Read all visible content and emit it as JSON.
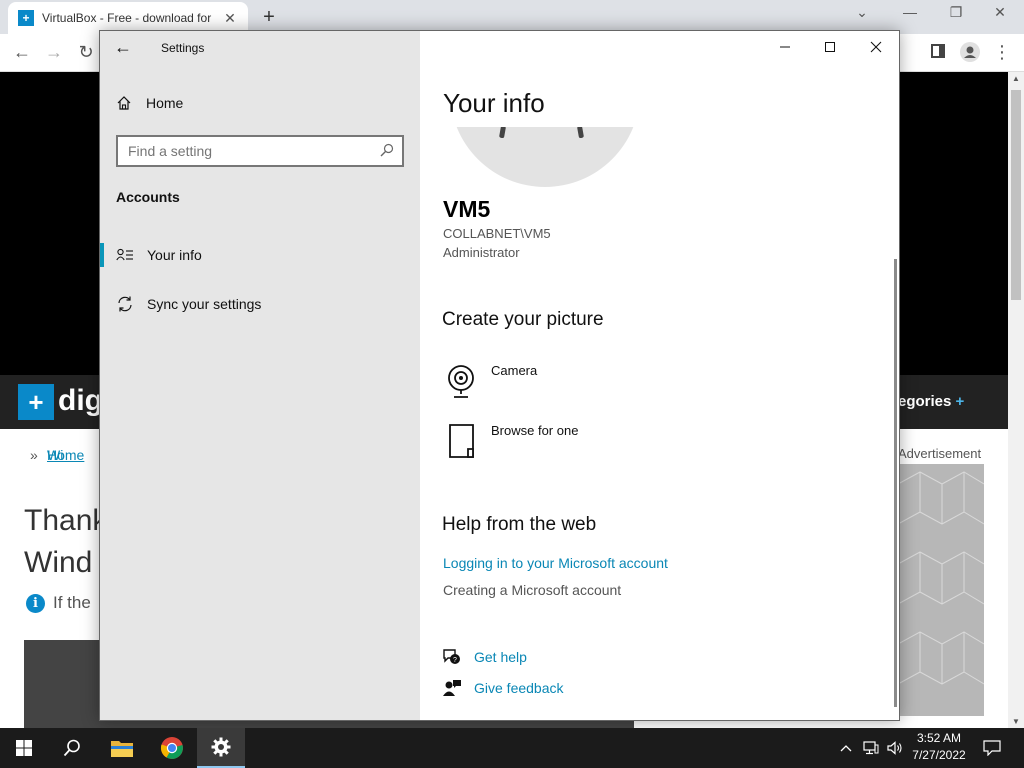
{
  "browser": {
    "tab_title": "VirtualBox - Free - download for",
    "tab_favicon": "digitaltrends-favicon",
    "tab_close": "✕",
    "new_tab": "+",
    "page": {
      "logo_text": "dig",
      "categories_label": "egories",
      "categories_plus": "+",
      "breadcrumb_home": "Home",
      "breadcrumb_sep": "»",
      "breadcrumb_next": "Wi",
      "headline_line1": "Thank",
      "headline_line2": "Wind",
      "info_text": "If the",
      "advertisement_label": "Advertisement"
    }
  },
  "settings": {
    "window_title": "Settings",
    "sidebar": {
      "home_label": "Home",
      "search_placeholder": "Find a setting",
      "group_label": "Accounts",
      "items": [
        {
          "label": "Your info",
          "icon": "person-list-icon",
          "active": true
        },
        {
          "label": "Sync your settings",
          "icon": "sync-icon",
          "active": false
        }
      ]
    },
    "content": {
      "page_title": "Your info",
      "user_name": "VM5",
      "user_domain": "COLLABNET\\VM5",
      "user_role": "Administrator",
      "create_picture_title": "Create your picture",
      "picture_options": [
        {
          "label": "Camera",
          "icon": "camera-icon"
        },
        {
          "label": "Browse for one",
          "icon": "file-icon"
        }
      ],
      "help_title": "Help from the web",
      "help_link": "Logging in to your Microsoft account",
      "help_text": "Creating a Microsoft account",
      "support": [
        {
          "label": "Get help",
          "icon": "get-help-icon"
        },
        {
          "label": "Give feedback",
          "icon": "feedback-icon"
        }
      ]
    }
  },
  "taskbar": {
    "time": "3:52 AM",
    "date": "7/27/2022",
    "pinned": [
      "windows-start-icon",
      "search-icon",
      "file-explorer-icon",
      "chrome-icon",
      "settings-gear-icon"
    ]
  },
  "colors": {
    "accent": "#0a96b9",
    "link": "#0a87b5",
    "sidebar_bg": "#e6e6e6",
    "taskbar_bg": "#1b1b1b"
  }
}
